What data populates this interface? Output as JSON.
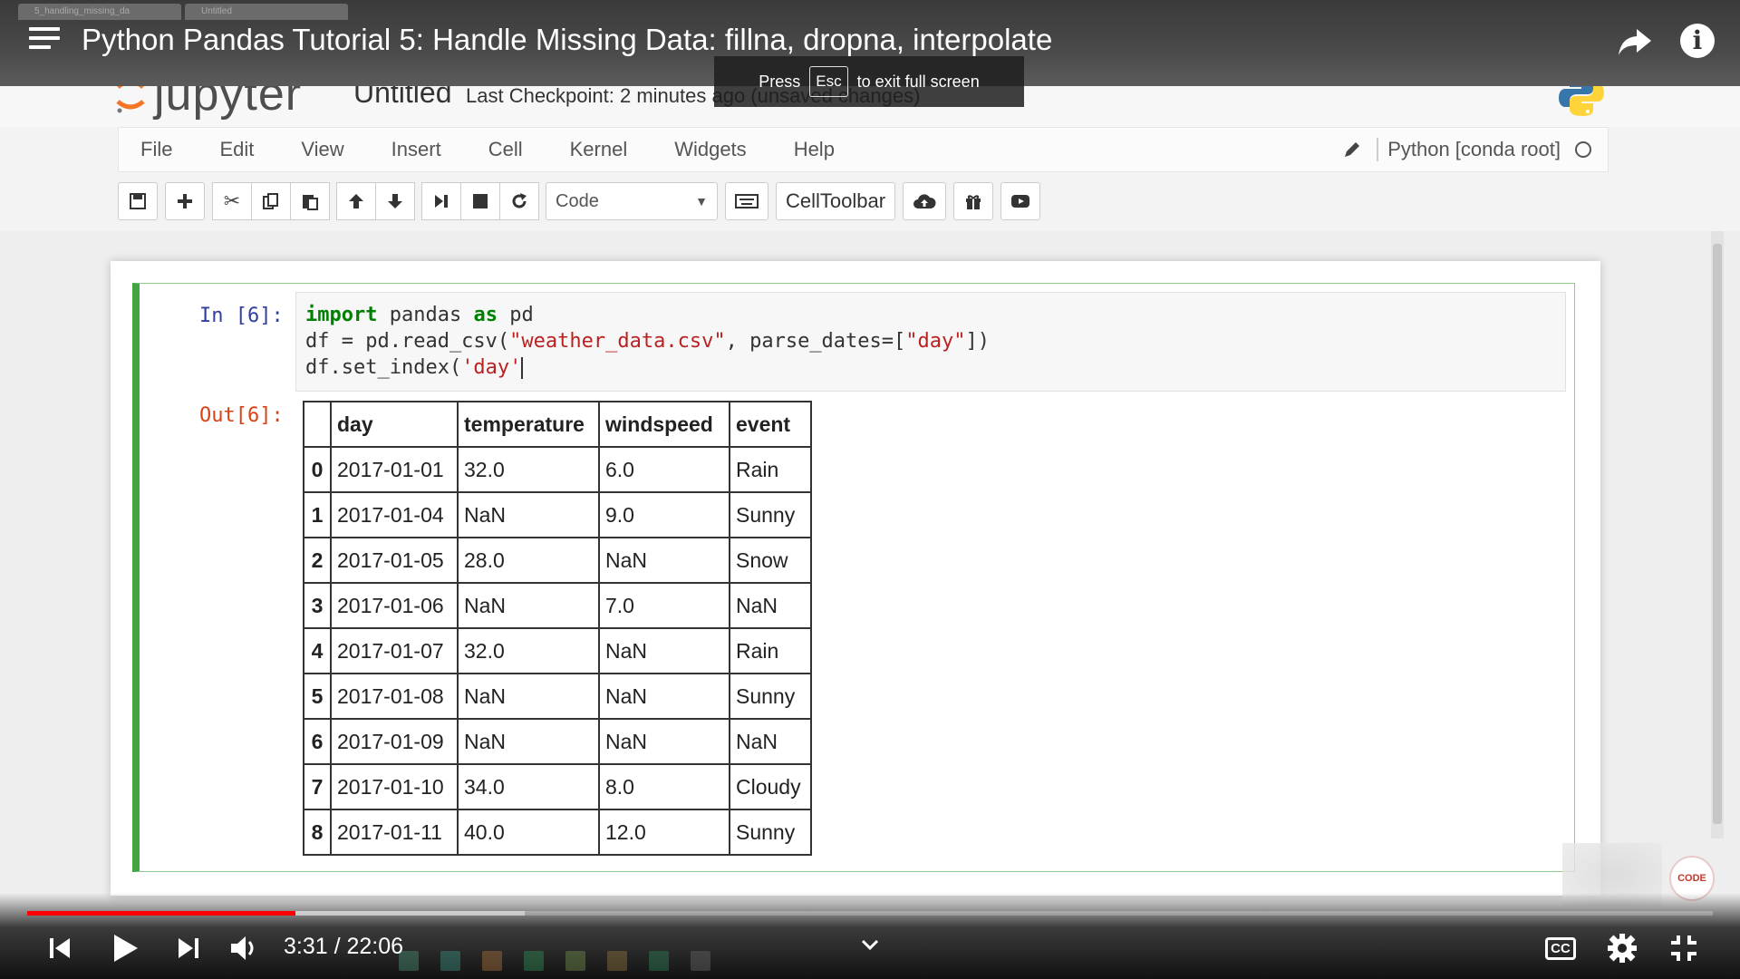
{
  "player": {
    "title": "Python Pandas Tutorial 5: Handle Missing Data: fillna, dropna, interpolate",
    "time_display": "3:31 / 22:06",
    "progress_fraction": 0.159,
    "buffer_fraction": 0.295,
    "fullscreen_toast": {
      "press": "Press",
      "key": "Esc",
      "suffix": "to exit full screen"
    },
    "cc_label": "CC",
    "accent_color": "#ff0000"
  },
  "browser": {
    "tabs": [
      "5_handling_missing_da",
      "Untitled"
    ]
  },
  "jupyter": {
    "logo_text": "jupyter",
    "notebook_name": "Untitled",
    "checkpoint": "Last Checkpoint: 2 minutes ago (unsaved changes)",
    "menu": [
      "File",
      "Edit",
      "View",
      "Insert",
      "Cell",
      "Kernel",
      "Widgets",
      "Help"
    ],
    "kernel_name": "Python [conda root]",
    "cell_type": "Code",
    "celltoolbar_label": "CellToolbar"
  },
  "cell": {
    "in_prompt": "In [6]:",
    "out_prompt": "Out[6]:",
    "code": {
      "line1_kw1": "import",
      "line1_mid": " pandas ",
      "line1_kw2": "as",
      "line1_end": " pd",
      "line2_a": "df = pd.read_csv(",
      "line2_str1": "\"weather_data.csv\"",
      "line2_b": ", parse_dates=[",
      "line2_str2": "\"day\"",
      "line2_c": "])",
      "line3_a": "df.set_index(",
      "line3_str": "'day'"
    }
  },
  "dataframe": {
    "columns": [
      "",
      "day",
      "temperature",
      "windspeed",
      "event"
    ],
    "rows": [
      [
        "0",
        "2017-01-01",
        "32.0",
        "6.0",
        "Rain"
      ],
      [
        "1",
        "2017-01-04",
        "NaN",
        "9.0",
        "Sunny"
      ],
      [
        "2",
        "2017-01-05",
        "28.0",
        "NaN",
        "Snow"
      ],
      [
        "3",
        "2017-01-06",
        "NaN",
        "7.0",
        "NaN"
      ],
      [
        "4",
        "2017-01-07",
        "32.0",
        "NaN",
        "Rain"
      ],
      [
        "5",
        "2017-01-08",
        "NaN",
        "NaN",
        "Sunny"
      ],
      [
        "6",
        "2017-01-09",
        "NaN",
        "NaN",
        "NaN"
      ],
      [
        "7",
        "2017-01-10",
        "34.0",
        "8.0",
        "Cloudy"
      ],
      [
        "8",
        "2017-01-11",
        "40.0",
        "12.0",
        "Sunny"
      ]
    ]
  },
  "icons": {
    "toolbar": [
      "save-icon",
      "add-cell-icon",
      "cut-icon",
      "copy-icon",
      "paste-icon",
      "move-up-icon",
      "move-down-icon",
      "run-icon",
      "stop-icon",
      "restart-icon",
      "keyboard-icon",
      "cloud-upload-icon",
      "gift-icon",
      "youtube-icon"
    ]
  }
}
